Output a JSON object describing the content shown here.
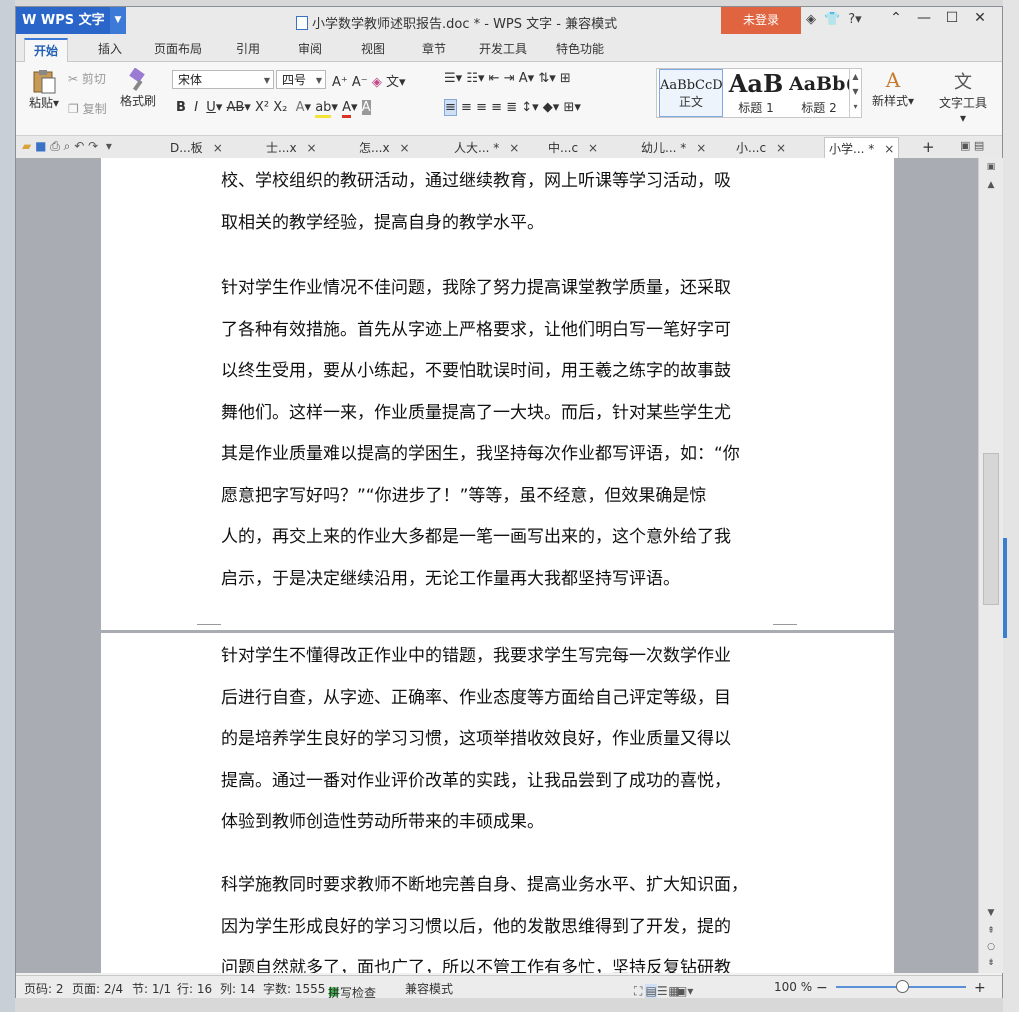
{
  "app": {
    "name": "WPS 文字",
    "title": "小学数学教师述职报告.doc * - WPS 文字 - 兼容模式",
    "login": "未登录"
  },
  "menu_tabs": [
    "开始",
    "插入",
    "页面布局",
    "引用",
    "审阅",
    "视图",
    "章节",
    "开发工具",
    "特色功能"
  ],
  "ribbon": {
    "paste": "粘贴",
    "cut": "剪切",
    "copy": "复制",
    "format_painter": "格式刷",
    "font_name": "宋体",
    "font_size": "四号",
    "styles": [
      {
        "preview": "AaBbCcD",
        "label": "正文"
      },
      {
        "preview": "AaB",
        "label": "标题 1"
      },
      {
        "preview": "AaBb(",
        "label": "标题 2"
      }
    ],
    "new_style": "新样式",
    "text_tools": "文字工具"
  },
  "doc_tabs": [
    {
      "label": "D...板",
      "active": false
    },
    {
      "label": "士...x",
      "active": false
    },
    {
      "label": "怎...x",
      "active": false
    },
    {
      "label": "人大... *",
      "active": false
    },
    {
      "label": "中...c",
      "active": false
    },
    {
      "label": "幼儿... *",
      "active": false
    },
    {
      "label": "小...c",
      "active": false
    },
    {
      "label": "小学... *",
      "active": true
    }
  ],
  "page1": {
    "para1": [
      "校、学校组织的教研活动，通过继续教育，网上听课等学习活动，吸",
      "取相关的教学经验，提高自身的教学水平。"
    ],
    "para2": [
      "针对学生作业情况不佳问题，我除了努力提高课堂教学质量，还采取",
      "了各种有效措施。首先从字迹上严格要求，让他们明白写一笔好字可",
      "以终生受用，要从小练起，不要怕耽误时间，用王羲之练字的故事鼓",
      "舞他们。这样一来，作业质量提高了一大块。而后，针对某些学生尤",
      "其是作业质量难以提高的学困生，我坚持每次作业都写评语，如：“你",
      "愿意把字写好吗？”“你进步了！”等等，虽不经意，但效果确是惊",
      "人的，再交上来的作业大多都是一笔一画写出来的，这个意外给了我",
      "启示，于是决定继续沿用，无论工作量再大我都坚持写评语。"
    ]
  },
  "page2": {
    "para1": [
      "针对学生不懂得改正作业中的错题，我要求学生写完每一次数学作业",
      "后进行自查，从字迹、正确率、作业态度等方面给自己评定等级，目",
      "的是培养学生良好的学习习惯，这项举措收效良好，作业质量又得以",
      "提高。通过一番对作业评价改革的实践，让我品尝到了成功的喜悦，",
      "体验到教师创造性劳动所带来的丰硕成果。"
    ],
    "para2": [
      "科学施教同时要求教师不断地完善自身、提高业务水平、扩大知识面，",
      "因为学生形成良好的学习习惯以后，他的发散思维得到了开发，提的",
      "问题自然就多了，面也广了，所以不管工作有多忙，坚持反复钻研教"
    ]
  },
  "status": {
    "page_code": "页码: 2",
    "pages": "页面: 2/4",
    "section": "节: 1/1",
    "row": "行: 16",
    "col": "列: 14",
    "words": "字数: 1555",
    "spell": "拼写检查",
    "compat": "兼容模式",
    "zoom": "100 %",
    "zoom_level": 1.0
  }
}
